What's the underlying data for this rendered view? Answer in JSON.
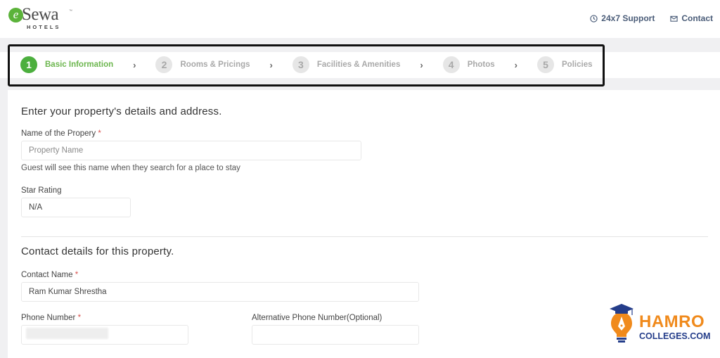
{
  "header": {
    "logo_letter": "e",
    "logo_brand": "Sewa",
    "logo_tm": "™",
    "logo_sub": "HOTELS",
    "links": [
      {
        "icon": "clock-icon",
        "label": "24x7 Support"
      },
      {
        "icon": "mail-icon",
        "label": "Contact"
      }
    ]
  },
  "stepper": {
    "steps": [
      {
        "number": "1",
        "label": "Basic Information",
        "active": true
      },
      {
        "number": "2",
        "label": "Rooms & Pricings",
        "active": false
      },
      {
        "number": "3",
        "label": "Facilities & Amenities",
        "active": false
      },
      {
        "number": "4",
        "label": "Photos",
        "active": false
      },
      {
        "number": "5",
        "label": "Policies",
        "active": false
      }
    ],
    "separator": "›",
    "active_color": "#4caf3e"
  },
  "property_section": {
    "title": "Enter your property's details and address.",
    "name_label": "Name of the Propery",
    "required_mark": "*",
    "name_placeholder": "Property Name",
    "name_value": "",
    "name_help": "Guest will see this name when they search for a place to stay",
    "star_label": "Star Rating",
    "star_value": "N/A"
  },
  "contact_section": {
    "title": "Contact details for this property.",
    "contact_name_label": "Contact Name",
    "contact_name_value": "Ram Kumar Shrestha",
    "phone_label": "Phone Number",
    "phone_value": "",
    "alt_phone_label": "Alternative Phone Number(Optional)",
    "alt_phone_value": ""
  },
  "watermark": {
    "line1": "HAMRO",
    "line2": "COLLEGES.COM"
  }
}
